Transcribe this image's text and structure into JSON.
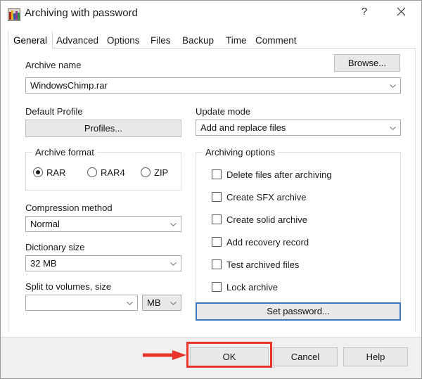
{
  "window": {
    "title": "Archiving with password",
    "icon": "winrar-books-icon",
    "help_button": "?",
    "close_button": "✕"
  },
  "tabs": [
    {
      "label": "General",
      "active": true
    },
    {
      "label": "Advanced",
      "active": false
    },
    {
      "label": "Options",
      "active": false
    },
    {
      "label": "Files",
      "active": false
    },
    {
      "label": "Backup",
      "active": false
    },
    {
      "label": "Time",
      "active": false
    },
    {
      "label": "Comment",
      "active": false
    }
  ],
  "archive_name": {
    "label": "Archive name",
    "value": "WindowsChimp.rar",
    "browse_button": "Browse..."
  },
  "default_profile": {
    "label": "Default Profile",
    "button": "Profiles..."
  },
  "update_mode": {
    "label": "Update mode",
    "value": "Add and replace files"
  },
  "archive_format": {
    "legend": "Archive format",
    "options": [
      {
        "label": "RAR",
        "selected": true
      },
      {
        "label": "RAR4",
        "selected": false
      },
      {
        "label": "ZIP",
        "selected": false
      }
    ]
  },
  "compression_method": {
    "label": "Compression method",
    "value": "Normal"
  },
  "dictionary_size": {
    "label": "Dictionary size",
    "value": "32 MB"
  },
  "split_to_volumes": {
    "label": "Split to volumes, size",
    "value": "",
    "unit": "MB"
  },
  "archiving_options": {
    "legend": "Archiving options",
    "items": [
      {
        "label": "Delete files after archiving",
        "checked": false
      },
      {
        "label": "Create SFX archive",
        "checked": false
      },
      {
        "label": "Create solid archive",
        "checked": false
      },
      {
        "label": "Add recovery record",
        "checked": false
      },
      {
        "label": "Test archived files",
        "checked": false
      },
      {
        "label": "Lock archive",
        "checked": false
      }
    ]
  },
  "set_password": {
    "label": "Set password...",
    "focused": true
  },
  "footer": {
    "ok": "OK",
    "cancel": "Cancel",
    "help": "Help"
  },
  "annotation": {
    "target": "OK",
    "highlight_color": "#e8352a",
    "arrow_color": "#e8352a"
  }
}
